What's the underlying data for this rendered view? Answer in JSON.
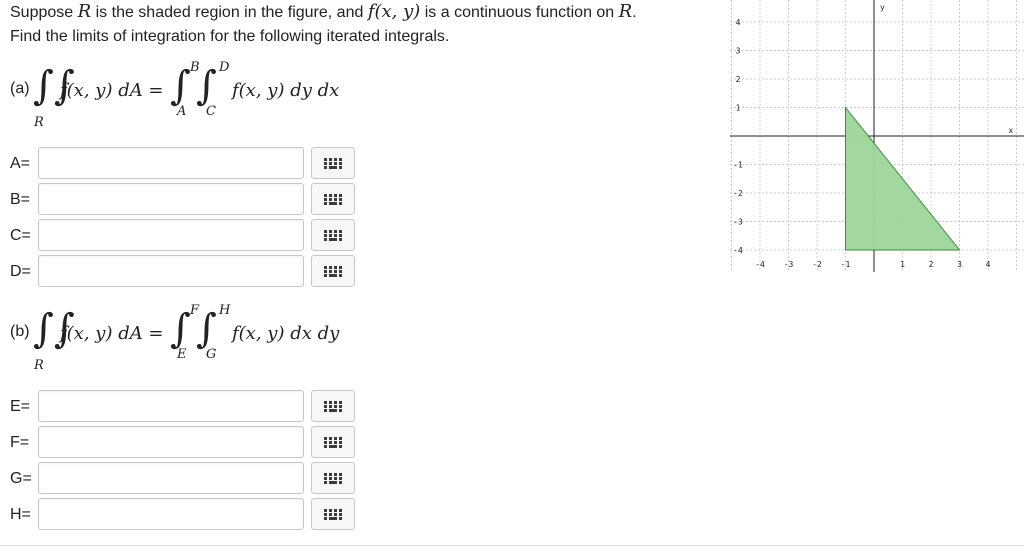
{
  "prompt": {
    "line1_a": "Suppose ",
    "line1_R": "R",
    "line1_b": " is the shaded region in the figure, and ",
    "line1_f": "f(x, y)",
    "line1_c": " is a continuous function on ",
    "line1_R2": "R",
    "line1_d": ".",
    "line2": "Find the limits of integration for the following iterated integrals."
  },
  "part_a": {
    "label": "(a)",
    "lhs_integrand": "f(x, y) dA =",
    "region": "R",
    "upper_outer": "B",
    "lower_outer": "A",
    "upper_inner": "D",
    "lower_inner": "C",
    "rhs_integrand": "f(x, y) dy dx",
    "fields": [
      {
        "label": "A=",
        "value": ""
      },
      {
        "label": "B=",
        "value": ""
      },
      {
        "label": "C=",
        "value": ""
      },
      {
        "label": "D=",
        "value": ""
      }
    ]
  },
  "part_b": {
    "label": "(b)",
    "lhs_integrand": "f(x, y) dA =",
    "region": "R",
    "upper_outer": "F",
    "lower_outer": "E",
    "upper_inner": "H",
    "lower_inner": "G",
    "rhs_integrand": "f(x, y) dx dy",
    "fields": [
      {
        "label": "E=",
        "value": ""
      },
      {
        "label": "F=",
        "value": ""
      },
      {
        "label": "G=",
        "value": ""
      },
      {
        "label": "H=",
        "value": ""
      }
    ]
  },
  "graph": {
    "x_axis_label": "x",
    "y_axis_label": "y",
    "x_ticks": [
      "-4",
      "-3",
      "-2",
      "-1",
      "1",
      "2",
      "3",
      "4"
    ],
    "y_ticks": [
      "4",
      "3",
      "2",
      "1",
      "-1",
      "-2",
      "-3",
      "-4"
    ],
    "region_vertices": [
      [
        -1,
        1
      ],
      [
        -1,
        -4
      ],
      [
        3,
        -4
      ]
    ],
    "region_fill": "#9dd69a",
    "region_stroke": "#3a8a3a"
  },
  "icons": {
    "keypad": "math-keypad-icon"
  }
}
